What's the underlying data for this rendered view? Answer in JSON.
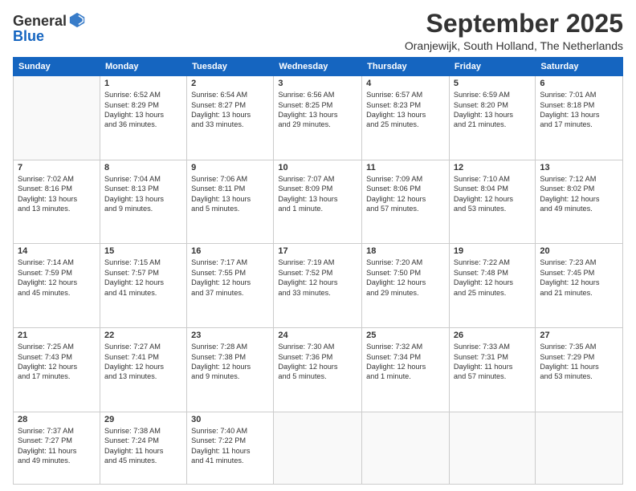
{
  "header": {
    "logo_line1": "General",
    "logo_line2": "Blue",
    "title": "September 2025",
    "subtitle": "Oranjewijk, South Holland, The Netherlands"
  },
  "weekdays": [
    "Sunday",
    "Monday",
    "Tuesday",
    "Wednesday",
    "Thursday",
    "Friday",
    "Saturday"
  ],
  "weeks": [
    [
      {
        "day": "",
        "info": ""
      },
      {
        "day": "1",
        "info": "Sunrise: 6:52 AM\nSunset: 8:29 PM\nDaylight: 13 hours\nand 36 minutes."
      },
      {
        "day": "2",
        "info": "Sunrise: 6:54 AM\nSunset: 8:27 PM\nDaylight: 13 hours\nand 33 minutes."
      },
      {
        "day": "3",
        "info": "Sunrise: 6:56 AM\nSunset: 8:25 PM\nDaylight: 13 hours\nand 29 minutes."
      },
      {
        "day": "4",
        "info": "Sunrise: 6:57 AM\nSunset: 8:23 PM\nDaylight: 13 hours\nand 25 minutes."
      },
      {
        "day": "5",
        "info": "Sunrise: 6:59 AM\nSunset: 8:20 PM\nDaylight: 13 hours\nand 21 minutes."
      },
      {
        "day": "6",
        "info": "Sunrise: 7:01 AM\nSunset: 8:18 PM\nDaylight: 13 hours\nand 17 minutes."
      }
    ],
    [
      {
        "day": "7",
        "info": "Sunrise: 7:02 AM\nSunset: 8:16 PM\nDaylight: 13 hours\nand 13 minutes."
      },
      {
        "day": "8",
        "info": "Sunrise: 7:04 AM\nSunset: 8:13 PM\nDaylight: 13 hours\nand 9 minutes."
      },
      {
        "day": "9",
        "info": "Sunrise: 7:06 AM\nSunset: 8:11 PM\nDaylight: 13 hours\nand 5 minutes."
      },
      {
        "day": "10",
        "info": "Sunrise: 7:07 AM\nSunset: 8:09 PM\nDaylight: 13 hours\nand 1 minute."
      },
      {
        "day": "11",
        "info": "Sunrise: 7:09 AM\nSunset: 8:06 PM\nDaylight: 12 hours\nand 57 minutes."
      },
      {
        "day": "12",
        "info": "Sunrise: 7:10 AM\nSunset: 8:04 PM\nDaylight: 12 hours\nand 53 minutes."
      },
      {
        "day": "13",
        "info": "Sunrise: 7:12 AM\nSunset: 8:02 PM\nDaylight: 12 hours\nand 49 minutes."
      }
    ],
    [
      {
        "day": "14",
        "info": "Sunrise: 7:14 AM\nSunset: 7:59 PM\nDaylight: 12 hours\nand 45 minutes."
      },
      {
        "day": "15",
        "info": "Sunrise: 7:15 AM\nSunset: 7:57 PM\nDaylight: 12 hours\nand 41 minutes."
      },
      {
        "day": "16",
        "info": "Sunrise: 7:17 AM\nSunset: 7:55 PM\nDaylight: 12 hours\nand 37 minutes."
      },
      {
        "day": "17",
        "info": "Sunrise: 7:19 AM\nSunset: 7:52 PM\nDaylight: 12 hours\nand 33 minutes."
      },
      {
        "day": "18",
        "info": "Sunrise: 7:20 AM\nSunset: 7:50 PM\nDaylight: 12 hours\nand 29 minutes."
      },
      {
        "day": "19",
        "info": "Sunrise: 7:22 AM\nSunset: 7:48 PM\nDaylight: 12 hours\nand 25 minutes."
      },
      {
        "day": "20",
        "info": "Sunrise: 7:23 AM\nSunset: 7:45 PM\nDaylight: 12 hours\nand 21 minutes."
      }
    ],
    [
      {
        "day": "21",
        "info": "Sunrise: 7:25 AM\nSunset: 7:43 PM\nDaylight: 12 hours\nand 17 minutes."
      },
      {
        "day": "22",
        "info": "Sunrise: 7:27 AM\nSunset: 7:41 PM\nDaylight: 12 hours\nand 13 minutes."
      },
      {
        "day": "23",
        "info": "Sunrise: 7:28 AM\nSunset: 7:38 PM\nDaylight: 12 hours\nand 9 minutes."
      },
      {
        "day": "24",
        "info": "Sunrise: 7:30 AM\nSunset: 7:36 PM\nDaylight: 12 hours\nand 5 minutes."
      },
      {
        "day": "25",
        "info": "Sunrise: 7:32 AM\nSunset: 7:34 PM\nDaylight: 12 hours\nand 1 minute."
      },
      {
        "day": "26",
        "info": "Sunrise: 7:33 AM\nSunset: 7:31 PM\nDaylight: 11 hours\nand 57 minutes."
      },
      {
        "day": "27",
        "info": "Sunrise: 7:35 AM\nSunset: 7:29 PM\nDaylight: 11 hours\nand 53 minutes."
      }
    ],
    [
      {
        "day": "28",
        "info": "Sunrise: 7:37 AM\nSunset: 7:27 PM\nDaylight: 11 hours\nand 49 minutes."
      },
      {
        "day": "29",
        "info": "Sunrise: 7:38 AM\nSunset: 7:24 PM\nDaylight: 11 hours\nand 45 minutes."
      },
      {
        "day": "30",
        "info": "Sunrise: 7:40 AM\nSunset: 7:22 PM\nDaylight: 11 hours\nand 41 minutes."
      },
      {
        "day": "",
        "info": ""
      },
      {
        "day": "",
        "info": ""
      },
      {
        "day": "",
        "info": ""
      },
      {
        "day": "",
        "info": ""
      }
    ]
  ]
}
